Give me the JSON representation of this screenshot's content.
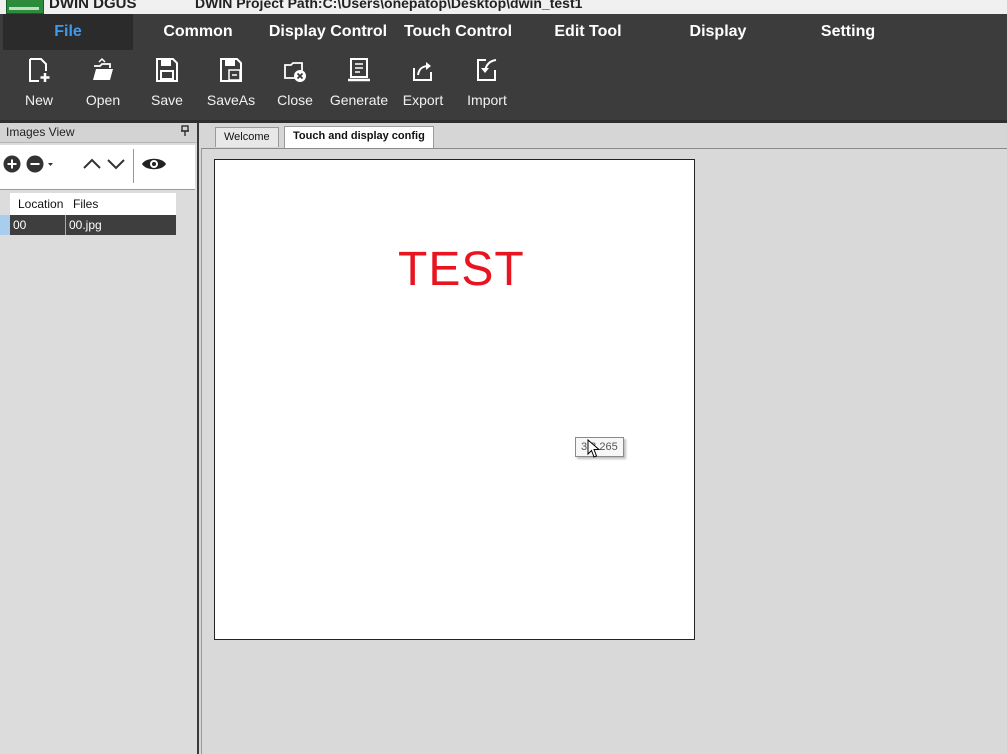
{
  "titlebar": {
    "app_name": "DWIN DGUS",
    "project_path": "DWIN Project Path:C:\\Users\\onepatop\\Desktop\\dwin_test1"
  },
  "menu": {
    "tabs": [
      {
        "label": "File",
        "active": true
      },
      {
        "label": "Common",
        "active": false
      },
      {
        "label": "Display Control",
        "active": false
      },
      {
        "label": "Touch Control",
        "active": false
      },
      {
        "label": "Edit Tool",
        "active": false
      },
      {
        "label": "Display",
        "active": false
      },
      {
        "label": "Setting",
        "active": false
      }
    ]
  },
  "toolbar": {
    "buttons": [
      {
        "label": "New",
        "icon": "new-file-icon"
      },
      {
        "label": "Open",
        "icon": "open-folder-icon"
      },
      {
        "label": "Save",
        "icon": "save-icon"
      },
      {
        "label": "SaveAs",
        "icon": "save-as-icon"
      },
      {
        "label": "Close",
        "icon": "close-project-icon"
      },
      {
        "label": "Generate",
        "icon": "generate-icon"
      },
      {
        "label": "Export",
        "icon": "export-icon"
      },
      {
        "label": "Import",
        "icon": "import-icon"
      }
    ]
  },
  "images_view": {
    "title": "Images View",
    "columns": [
      "Location",
      "Files"
    ],
    "rows": [
      {
        "location": "00",
        "file": "00.jpg"
      }
    ]
  },
  "doc_tabs": [
    {
      "label": "Welcome",
      "active": false
    },
    {
      "label": "Touch and display config",
      "active": true
    }
  ],
  "canvas": {
    "text": "TEST",
    "text_color": "#e8141f",
    "coord_readout": "3 3 265"
  },
  "colors": {
    "active_menu": "#3a9bef",
    "toolbar_bg": "#3c3c3c"
  }
}
